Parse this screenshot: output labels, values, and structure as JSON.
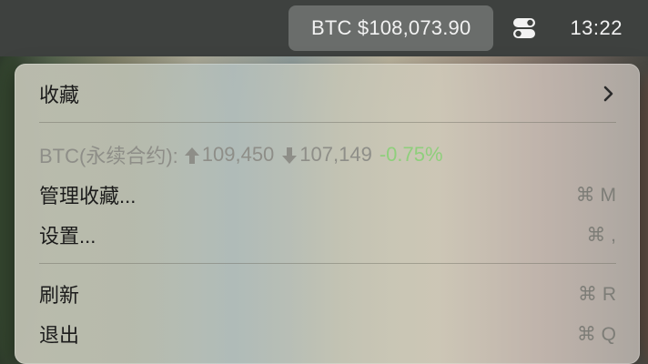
{
  "menubar": {
    "ticker_label": "BTC $108,073.90",
    "control_center_icon": "control-center-toggles-icon",
    "clock": "13:22"
  },
  "menu": {
    "favorites": {
      "label": "收藏",
      "submenu_icon": "chevron-right-icon"
    },
    "ticker": {
      "symbol": "BTC(永续合约):",
      "high_icon": "arrow-up-icon",
      "high": "109,450",
      "low_icon": "arrow-down-icon",
      "low": "107,149",
      "change": "-0.75%",
      "change_color": "#8fcf7c"
    },
    "manage_favorites": {
      "label": "管理收藏...",
      "shortcut": "⌘ M"
    },
    "settings": {
      "label": "设置...",
      "shortcut": "⌘ ,"
    },
    "refresh": {
      "label": "刷新",
      "shortcut": "⌘ R"
    },
    "quit": {
      "label": "退出",
      "shortcut": "⌘ Q"
    }
  }
}
